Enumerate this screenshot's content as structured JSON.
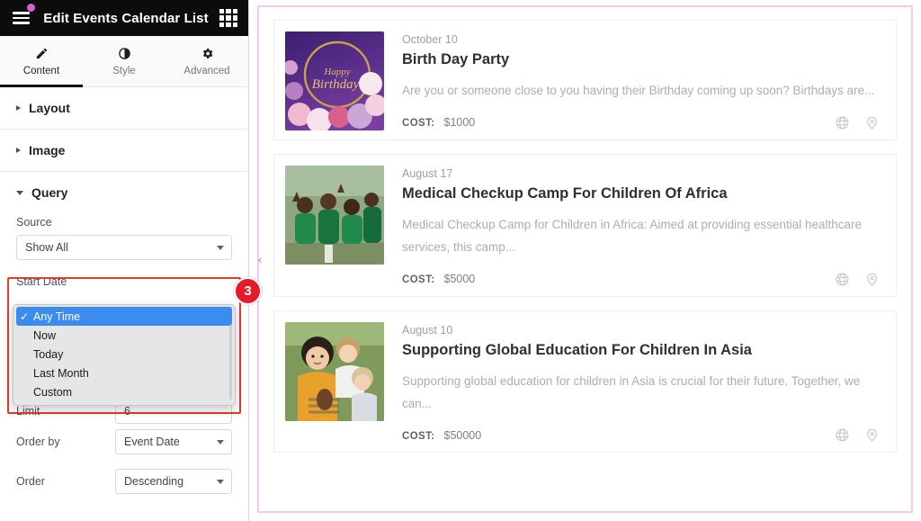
{
  "panel": {
    "header": {
      "menu_icon": "hamburger-icon",
      "badge_dot": true,
      "title": "Edit Events Calendar List",
      "grid_icon": "apps-grid-icon"
    },
    "tabs": [
      {
        "label": "Content",
        "icon": "pencil-icon",
        "active": true
      },
      {
        "label": "Style",
        "icon": "contrast-circle-icon",
        "active": false
      },
      {
        "label": "Advanced",
        "icon": "gear-icon",
        "active": false
      }
    ],
    "sections": [
      {
        "label": "Layout",
        "open": false
      },
      {
        "label": "Image",
        "open": false
      },
      {
        "label": "Query",
        "open": true
      }
    ],
    "query": {
      "source_label": "Source",
      "source_value": "Show All",
      "start_date_label": "Start Date",
      "start_date_options": [
        {
          "label": "Any Time",
          "selected": true
        },
        {
          "label": "Now",
          "selected": false
        },
        {
          "label": "Today",
          "selected": false
        },
        {
          "label": "Last Month",
          "selected": false
        },
        {
          "label": "Custom",
          "selected": false
        }
      ],
      "limit_label": "Limit",
      "limit_value": "6",
      "order_by_label": "Order by",
      "order_by_value": "Event Date",
      "order_label": "Order",
      "order_value": "Descending"
    },
    "step_badge": "3",
    "highlight_color": "#e8392c"
  },
  "canvas": {
    "collapse_icon": "chevron-left-icon",
    "border_color": "#f4c9f2",
    "events": [
      {
        "date": "October 10",
        "title": "Birth Day Party",
        "description": "Are you or someone close to you having their Birthday coming up soon? Birthdays are...",
        "cost_label": "COST:",
        "cost_value": "$1000",
        "thumb": "birthday-balloons-image",
        "icons": [
          "globe-icon",
          "map-pin-icon"
        ]
      },
      {
        "date": "August 17",
        "title": "Medical Checkup Camp For Children Of Africa",
        "description": "Medical Checkup Camp for Children in Africa: Aimed at providing essential healthcare services, this camp...",
        "cost_label": "COST:",
        "cost_value": "$5000",
        "thumb": "african-children-image",
        "icons": [
          "globe-icon",
          "map-pin-icon"
        ]
      },
      {
        "date": "August 10",
        "title": "Supporting Global Education For Children In Asia",
        "description": "Supporting global education for children in Asia is crucial for their future. Together, we can...",
        "cost_label": "COST:",
        "cost_value": "$50000",
        "thumb": "asian-children-image",
        "icons": [
          "globe-icon",
          "map-pin-icon"
        ]
      }
    ]
  }
}
